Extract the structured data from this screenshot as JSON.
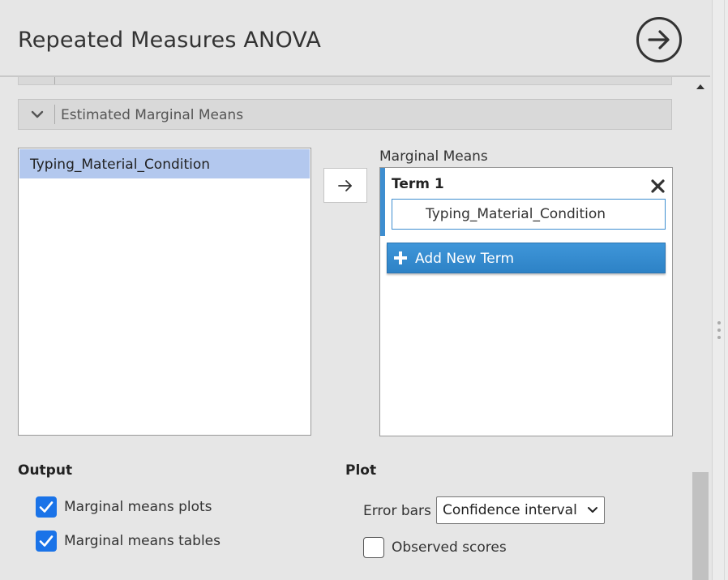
{
  "header": {
    "title": "Repeated Measures ANOVA",
    "go_icon": "arrow-right-circle-icon"
  },
  "section": {
    "label": "Estimated Marginal Means",
    "expanded": true
  },
  "variables": [
    "Typing_Material_Condition"
  ],
  "marginal_means": {
    "label": "Marginal Means",
    "terms": [
      {
        "title": "Term 1",
        "value": "Typing_Material_Condition"
      }
    ],
    "add_term_label": "Add New Term"
  },
  "output": {
    "heading": "Output",
    "options": [
      {
        "label": "Marginal means plots",
        "checked": true
      },
      {
        "label": "Marginal means tables",
        "checked": true
      }
    ]
  },
  "plot": {
    "heading": "Plot",
    "error_bars_label": "Error bars",
    "error_bars_value": "Confidence interval",
    "observed_scores_label": "Observed scores",
    "observed_scores_checked": false
  },
  "colors": {
    "accent": "#3e8ed0",
    "checkbox": "#1a73e8",
    "selection": "#b3c8ee"
  }
}
